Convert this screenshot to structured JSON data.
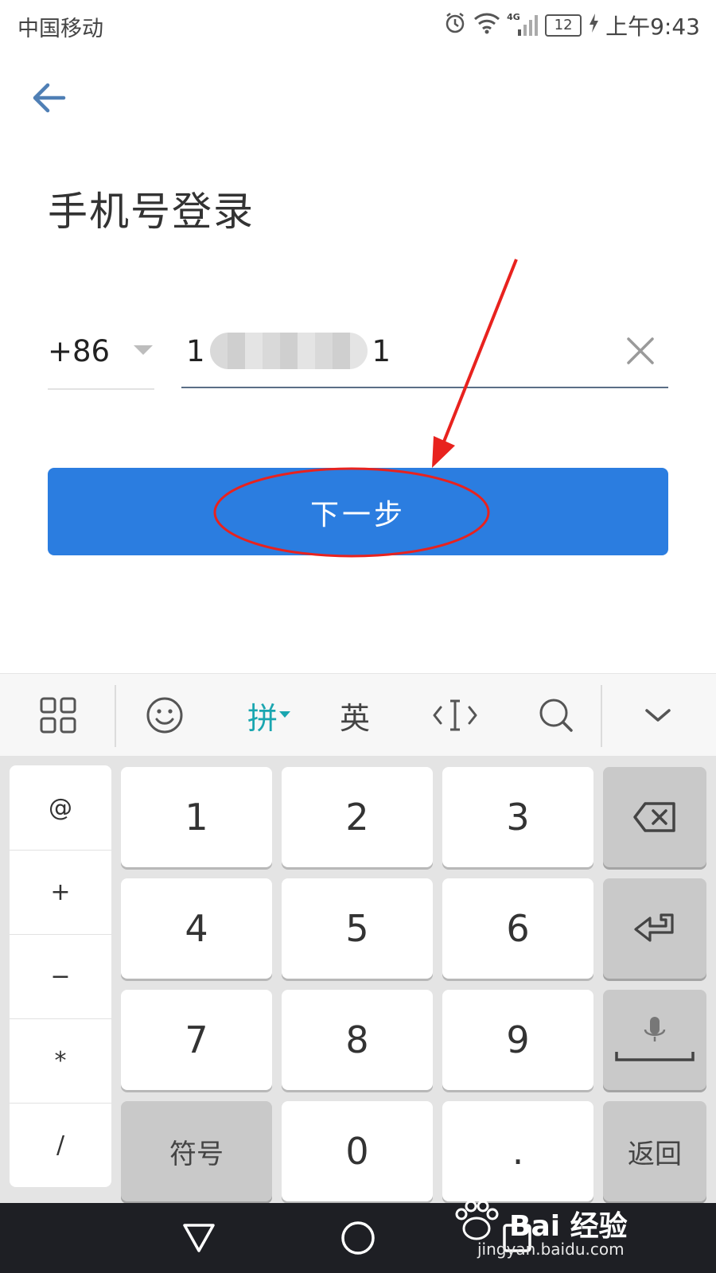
{
  "status_bar": {
    "carrier": "中国移动",
    "network": "4G",
    "battery": "12",
    "time": "上午9:43"
  },
  "header": {
    "title": "手机号登录"
  },
  "form": {
    "country_code": "+86",
    "phone_first_digit": "1",
    "phone_last_digit": "1",
    "next_button": "下一步"
  },
  "colors": {
    "primary": "#2b7de0",
    "annotation": "#e8221e",
    "ime_accent": "#1aa6b0"
  },
  "keyboard": {
    "toolbar": {
      "pinyin": "拼",
      "english": "英"
    },
    "symbols": [
      "@",
      "+",
      "−",
      "*",
      "/"
    ],
    "digits": [
      "1",
      "2",
      "3",
      "4",
      "5",
      "6",
      "7",
      "8",
      "9",
      "0"
    ],
    "symbols_key": "符号",
    "dot_key": ".",
    "return_key": "返回"
  },
  "watermark": {
    "brand": "Bai 经验",
    "site": "jingyan.baidu.com"
  }
}
